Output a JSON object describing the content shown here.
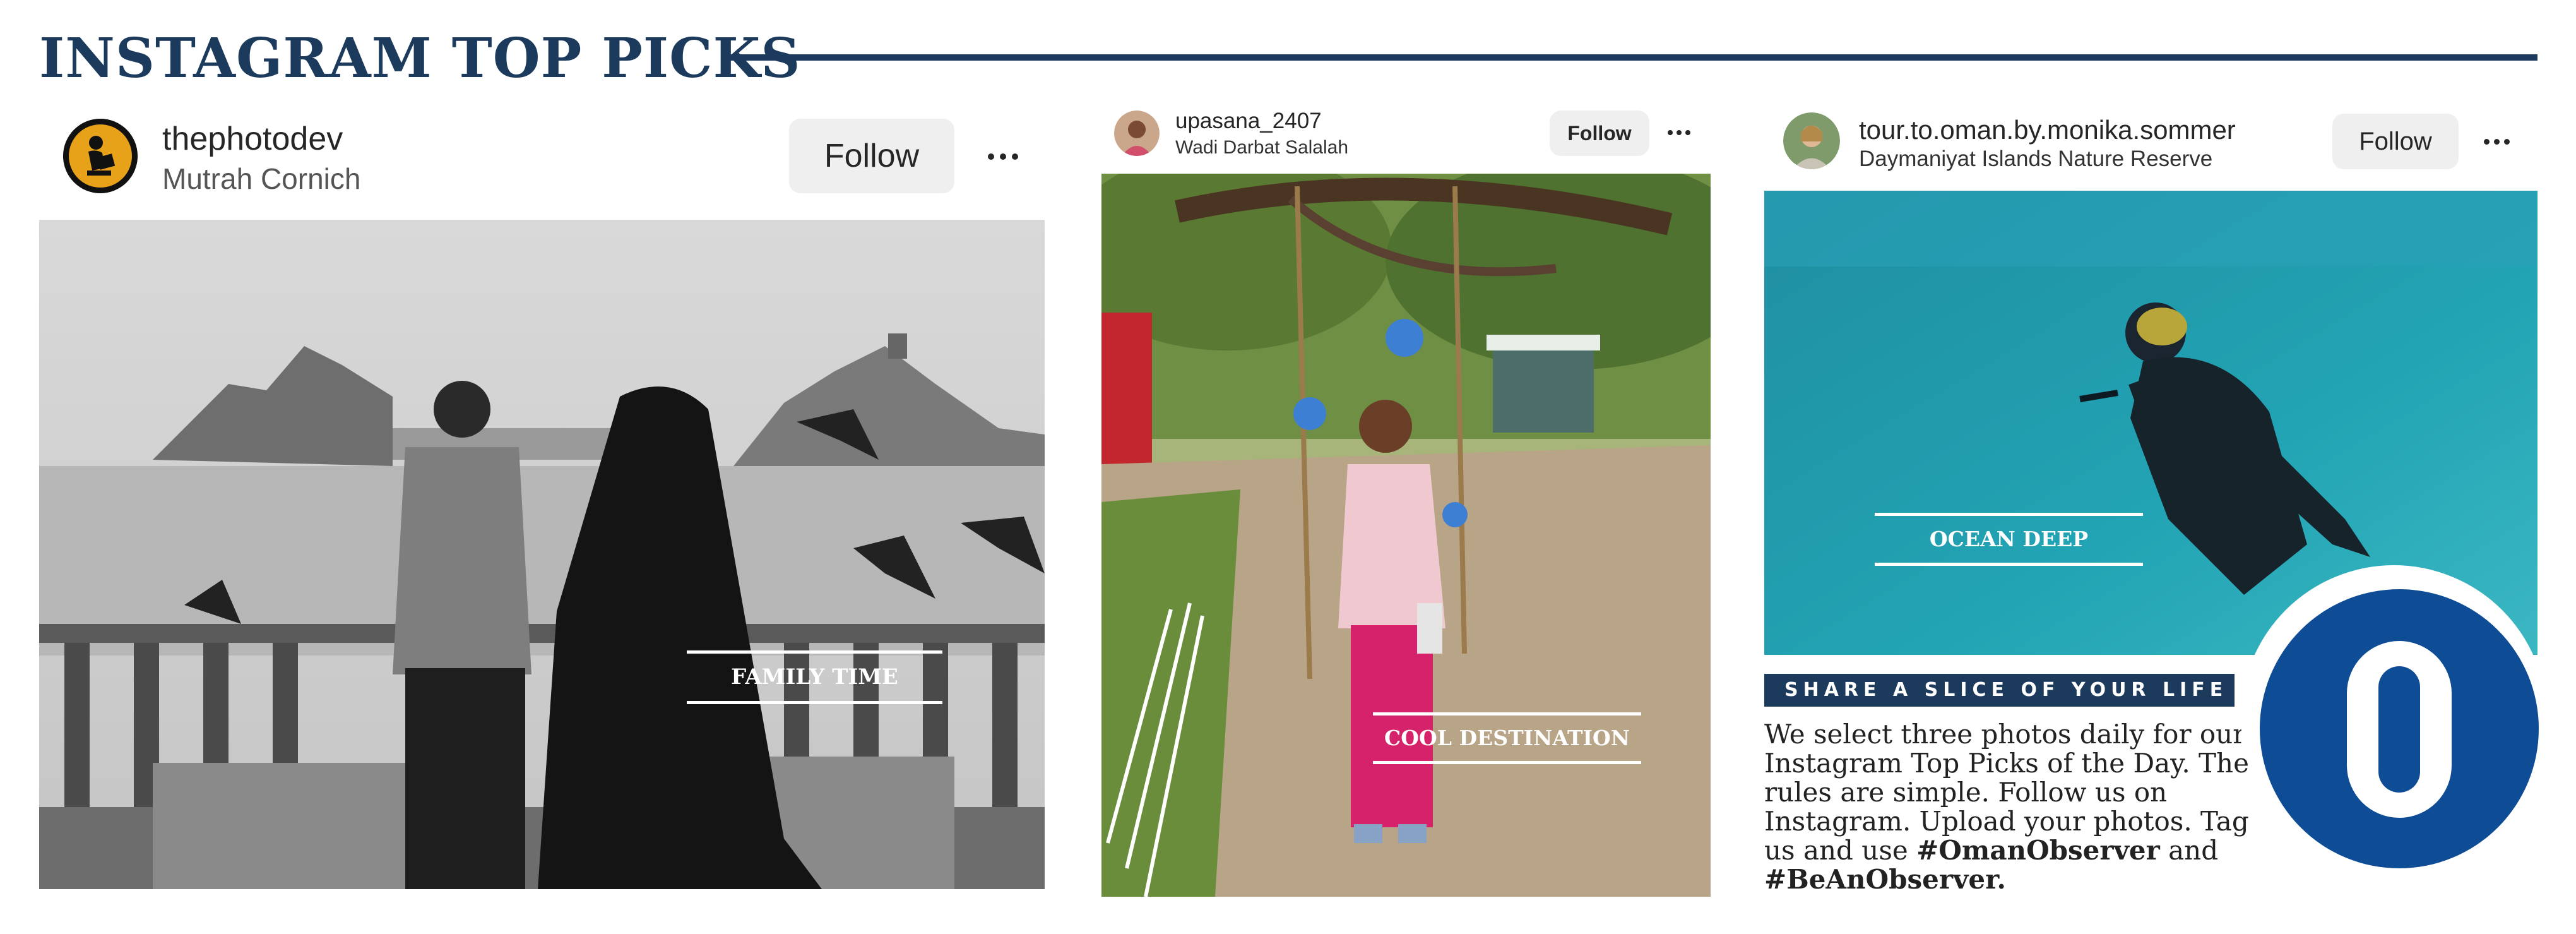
{
  "page": {
    "title": "INSTAGRAM TOP PICKS"
  },
  "posts": [
    {
      "username": "thephotodev",
      "location": "Mutrah Cornich",
      "follow_label": "Follow",
      "photo_caption": "FAMILY TIME",
      "avatar_icon": "reader-silhouette-icon"
    },
    {
      "username": "upasana_2407",
      "location": "Wadi Darbat Salalah",
      "follow_label": "Follow",
      "photo_caption": "COOL DESTINATION",
      "avatar_icon": "portrait-avatar"
    },
    {
      "username": "tour.to.oman.by.monika.sommer",
      "location": "Daymaniyat Islands Nature Reserve",
      "follow_label": "Follow",
      "photo_caption": "OCEAN DEEP",
      "avatar_icon": "portrait-avatar"
    }
  ],
  "share": {
    "heading": "SHARE A SLICE OF YOUR LIFE",
    "body": "We select three photos daily for our Instagram Top Picks of the Day. The rules are simple. Follow us on Instagram. Upload your photos. Tag us and use",
    "tag1": "#OmanObserver",
    "and": "and",
    "tag2": "#BeAnObserver."
  },
  "logo": {
    "letter": "O",
    "color": "#0e4d95"
  },
  "colors": {
    "navy": "#1c3a5c",
    "follow_bg": "#efefef"
  }
}
